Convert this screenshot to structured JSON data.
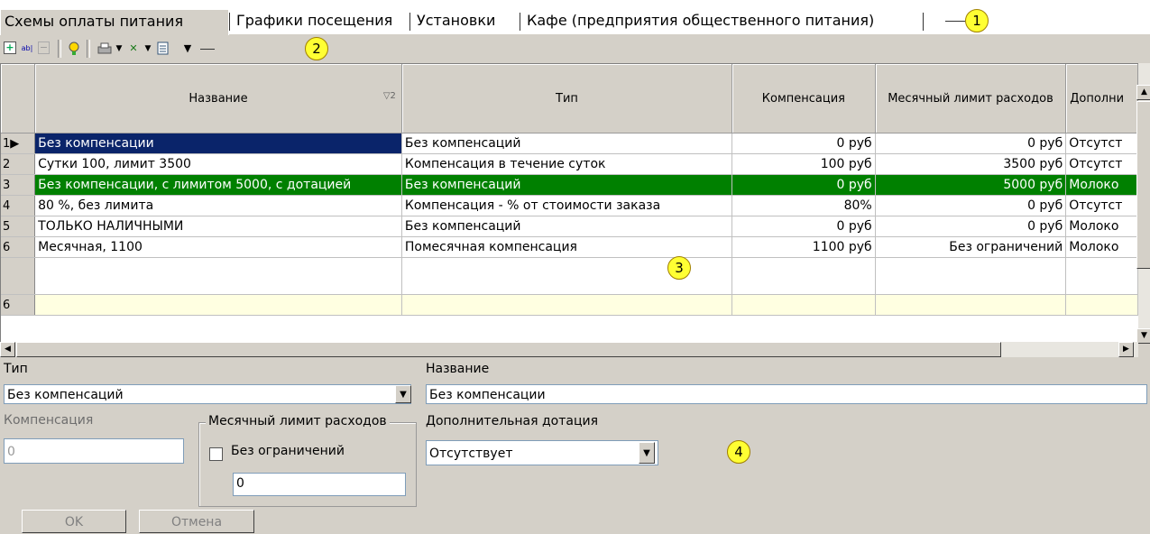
{
  "tabs": [
    {
      "label": "Схемы оплаты питания",
      "active": true
    },
    {
      "label": "Графики посещения",
      "active": false
    },
    {
      "label": "Установки",
      "active": false
    },
    {
      "label": "Кафе (предприятия общественного питания)",
      "active": false
    }
  ],
  "callouts": [
    "1",
    "2",
    "3",
    "4"
  ],
  "toolbar": {
    "icons": [
      "add-record-icon",
      "rename-icon",
      "delete-icon",
      "tip-icon",
      "print-icon",
      "excel-export-icon",
      "columns-icon"
    ]
  },
  "grid": {
    "columns": [
      "Название",
      "Тип",
      "Компенсация",
      "Месячный лимит расходов",
      "Дополни"
    ],
    "sort_indicator": "▽2",
    "rows": [
      {
        "num": "1",
        "name": "Без компенсации",
        "type": "Без компенсаций",
        "comp": "0 руб",
        "limit": "0 руб",
        "extra": "Отсутст"
      },
      {
        "num": "2",
        "name": "Сутки 100, лимит 3500",
        "type": "Компенсация в течение суток",
        "comp": "100 руб",
        "limit": "3500 руб",
        "extra": "Отсутст"
      },
      {
        "num": "3",
        "name": "Без компенсации, с лимитом 5000, с дотацией",
        "type": "Без компенсаций",
        "comp": "0 руб",
        "limit": "5000 руб",
        "extra": "Молоко"
      },
      {
        "num": "4",
        "name": "80 %, без лимита",
        "type": "Компенсация - % от стоимости заказа",
        "comp": "80%",
        "limit": "0 руб",
        "extra": "Отсутст"
      },
      {
        "num": "5",
        "name": "ТОЛЬКО НАЛИЧНЫМИ",
        "type": "Без компенсаций",
        "comp": "0 руб",
        "limit": "0 руб",
        "extra": "Молоко"
      },
      {
        "num": "6",
        "name": "Месячная, 1100",
        "type": "Помесячная компенсация",
        "comp": "1100 руб",
        "limit": "Без ограничений",
        "extra": "Молоко"
      }
    ],
    "footer_count": "6"
  },
  "form": {
    "type_label": "Тип",
    "type_value": "Без компенсаций",
    "name_label": "Название",
    "name_value": "Без компенсации",
    "comp_label": "Компенсация",
    "comp_value": "0",
    "limit_group_label": "Месячный лимит расходов",
    "unlimited_label": "Без ограничений",
    "limit_value": "0",
    "extra_label": "Дополнительная дотация",
    "extra_value": "Отсутствует",
    "ok_label": "OK",
    "cancel_label": "Отмена"
  }
}
